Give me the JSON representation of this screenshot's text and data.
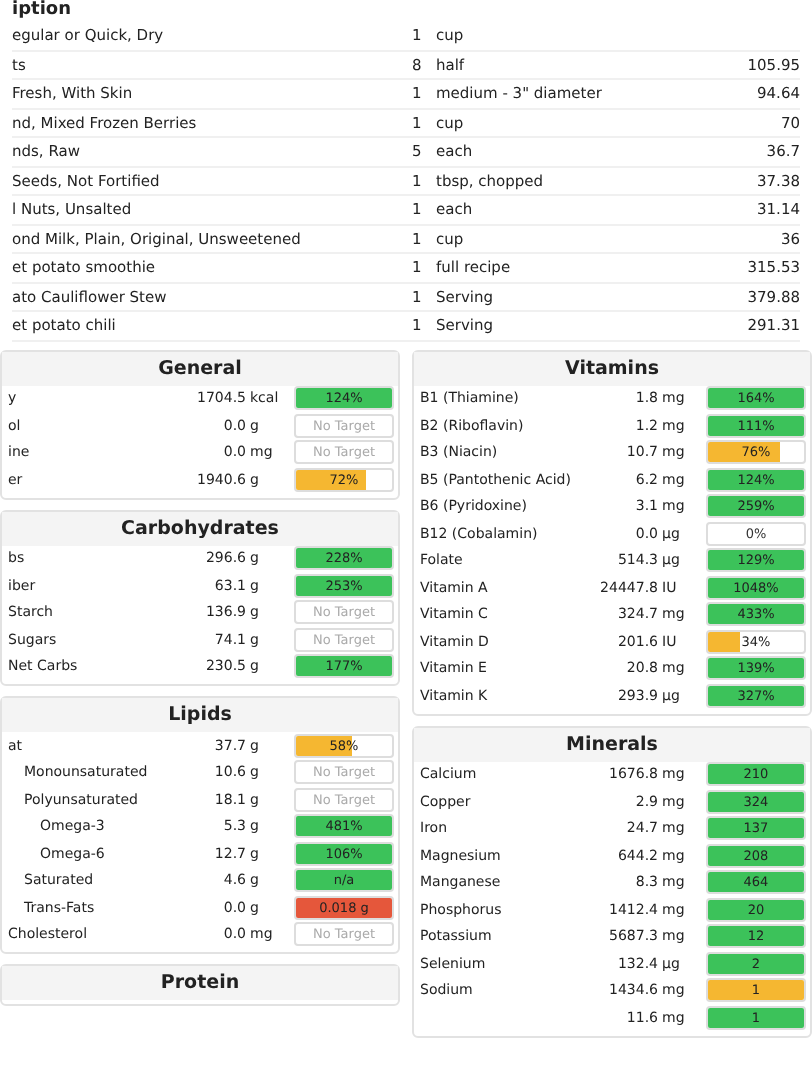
{
  "food_log": {
    "header": "iption",
    "rows": [
      {
        "description": "egular or Quick, Dry",
        "amount": "1",
        "unit": "cup"
      },
      {
        "description": "ts",
        "amount": "8",
        "unit": "half",
        "calories": "105.95"
      },
      {
        "description": "Fresh, With Skin",
        "amount": "1",
        "unit": "medium - 3\" diameter",
        "calories": "94.64"
      },
      {
        "description": "nd, Mixed Frozen Berries",
        "amount": "1",
        "unit": "cup",
        "calories": "70"
      },
      {
        "description": "nds, Raw",
        "amount": "5",
        "unit": "each",
        "calories": "36.7"
      },
      {
        "description": "Seeds, Not Fortified",
        "amount": "1",
        "unit": "tbsp, chopped",
        "calories": "37.38"
      },
      {
        "description": "l Nuts, Unsalted",
        "amount": "1",
        "unit": "each",
        "calories": "31.14"
      },
      {
        "description": "ond Milk, Plain, Original, Unsweetened",
        "amount": "1",
        "unit": "cup",
        "calories": "36"
      },
      {
        "description": "et potato smoothie",
        "amount": "1",
        "unit": "full recipe",
        "calories": "315.53"
      },
      {
        "description": "ato Cauliflower Stew",
        "amount": "1",
        "unit": "Serving",
        "calories": "379.88"
      },
      {
        "description": "et potato chili",
        "amount": "1",
        "unit": "Serving",
        "calories": "291.31"
      }
    ]
  },
  "left_sections": [
    {
      "title": "General",
      "rows": [
        {
          "label": "y",
          "value": "1704.5",
          "unit": "kcal",
          "target": {
            "kind": "bar",
            "text": "124%",
            "level": 1,
            "color": "#3cc25a"
          }
        },
        {
          "label": "ol",
          "value": "0.0",
          "unit": "g",
          "target": {
            "kind": "none",
            "text": "No Target"
          }
        },
        {
          "label": "ine",
          "value": "0.0",
          "unit": "mg",
          "target": {
            "kind": "none",
            "text": "No Target"
          }
        },
        {
          "label": "er",
          "value": "1940.6",
          "unit": "g",
          "target": {
            "kind": "bar",
            "text": "72%",
            "level": 0.72,
            "color": "#f5b731"
          }
        }
      ]
    },
    {
      "title": "Carbohydrates",
      "rows": [
        {
          "label": "bs",
          "value": "296.6",
          "unit": "g",
          "target": {
            "kind": "bar",
            "text": "228%",
            "level": 1,
            "color": "#3cc25a"
          }
        },
        {
          "label": "iber",
          "value": "63.1",
          "unit": "g",
          "target": {
            "kind": "bar",
            "text": "253%",
            "level": 1,
            "color": "#3cc25a"
          }
        },
        {
          "label": "Starch",
          "value": "136.9",
          "unit": "g",
          "target": {
            "kind": "none",
            "text": "No Target"
          }
        },
        {
          "label": "Sugars",
          "value": "74.1",
          "unit": "g",
          "target": {
            "kind": "none",
            "text": "No Target"
          }
        },
        {
          "label": "Net Carbs",
          "value": "230.5",
          "unit": "g",
          "target": {
            "kind": "bar",
            "text": "177%",
            "level": 1,
            "color": "#3cc25a"
          }
        }
      ]
    },
    {
      "title": "Lipids",
      "rows": [
        {
          "label": "at",
          "value": "37.7",
          "unit": "g",
          "target": {
            "kind": "bar",
            "text": "58%",
            "level": 0.58,
            "color": "#f5b731"
          },
          "children": [
            {
              "label": "Monounsaturated",
              "value": "10.6",
              "unit": "g",
              "target": {
                "kind": "none",
                "text": "No Target"
              }
            },
            {
              "label": "Polyunsaturated",
              "value": "18.1",
              "unit": "g",
              "target": {
                "kind": "none",
                "text": "No Target"
              },
              "children": [
                {
                  "label": "Omega-3",
                  "value": "5.3",
                  "unit": "g",
                  "target": {
                    "kind": "bar",
                    "text": "481%",
                    "level": 1,
                    "color": "#3cc25a"
                  }
                },
                {
                  "label": "Omega-6",
                  "value": "12.7",
                  "unit": "g",
                  "target": {
                    "kind": "bar",
                    "text": "106%",
                    "level": 1,
                    "color": "#3cc25a"
                  }
                }
              ]
            },
            {
              "label": "Saturated",
              "value": "4.6",
              "unit": "g",
              "target": {
                "kind": "bar",
                "text": "n/a",
                "level": 1,
                "color": "#3cc25a"
              }
            },
            {
              "label": "Trans-Fats",
              "value": "0.0",
              "unit": "g",
              "target": {
                "kind": "bar",
                "text": "0.018 g",
                "level": 1,
                "color": "#e5573b"
              }
            }
          ]
        },
        {
          "label": "Cholesterol",
          "value": "0.0",
          "unit": "mg",
          "target": {
            "kind": "none",
            "text": "No Target"
          }
        }
      ]
    },
    {
      "title": "Protein"
    }
  ],
  "right_sections": [
    {
      "title": "Vitamins",
      "rows": [
        {
          "label": "B1 (Thiamine)",
          "value": "1.8",
          "unit": "mg",
          "target": {
            "kind": "bar",
            "text": "164%",
            "level": 1,
            "color": "#3cc25a"
          }
        },
        {
          "label": "B2 (Riboflavin)",
          "value": "1.2",
          "unit": "mg",
          "target": {
            "kind": "bar",
            "text": "111%",
            "level": 1,
            "color": "#3cc25a"
          }
        },
        {
          "label": "B3 (Niacin)",
          "value": "10.7",
          "unit": "mg",
          "target": {
            "kind": "bar",
            "text": "76%",
            "level": 0.76,
            "color": "#f5b731"
          }
        },
        {
          "label": "B5 (Pantothenic Acid)",
          "value": "6.2",
          "unit": "mg",
          "target": {
            "kind": "bar",
            "text": "124%",
            "level": 1,
            "color": "#3cc25a"
          }
        },
        {
          "label": "B6 (Pyridoxine)",
          "value": "3.1",
          "unit": "mg",
          "target": {
            "kind": "bar",
            "text": "259%",
            "level": 1,
            "color": "#3cc25a"
          }
        },
        {
          "label": "B12 (Cobalamin)",
          "value": "0.0",
          "unit": "µg",
          "target": {
            "kind": "empty",
            "text": "0%"
          }
        },
        {
          "label": "Folate",
          "value": "514.3",
          "unit": "µg",
          "target": {
            "kind": "bar",
            "text": "129%",
            "level": 1,
            "color": "#3cc25a"
          }
        },
        {
          "label": "Vitamin A",
          "value": "24447.8",
          "unit": "IU",
          "target": {
            "kind": "bar",
            "text": "1048%",
            "level": 1,
            "color": "#3cc25a"
          }
        },
        {
          "label": "Vitamin C",
          "value": "324.7",
          "unit": "mg",
          "target": {
            "kind": "bar",
            "text": "433%",
            "level": 1,
            "color": "#3cc25a"
          }
        },
        {
          "label": "Vitamin D",
          "value": "201.6",
          "unit": "IU",
          "target": {
            "kind": "bar",
            "text": "34%",
            "level": 0.34,
            "color": "#f5b731"
          }
        },
        {
          "label": "Vitamin E",
          "value": "20.8",
          "unit": "mg",
          "target": {
            "kind": "bar",
            "text": "139%",
            "level": 1,
            "color": "#3cc25a"
          }
        },
        {
          "label": "Vitamin K",
          "value": "293.9",
          "unit": "µg",
          "target": {
            "kind": "bar",
            "text": "327%",
            "level": 1,
            "color": "#3cc25a"
          }
        }
      ]
    },
    {
      "title": "Minerals",
      "rows": [
        {
          "label": "Calcium",
          "value": "1676.8",
          "unit": "mg",
          "target": {
            "kind": "bar",
            "text": "210",
            "level": 1,
            "color": "#3cc25a"
          }
        },
        {
          "label": "Copper",
          "value": "2.9",
          "unit": "mg",
          "target": {
            "kind": "bar",
            "text": "324",
            "level": 1,
            "color": "#3cc25a"
          }
        },
        {
          "label": "Iron",
          "value": "24.7",
          "unit": "mg",
          "target": {
            "kind": "bar",
            "text": "137",
            "level": 1,
            "color": "#3cc25a"
          }
        },
        {
          "label": "Magnesium",
          "value": "644.2",
          "unit": "mg",
          "target": {
            "kind": "bar",
            "text": "208",
            "level": 1,
            "color": "#3cc25a"
          }
        },
        {
          "label": "Manganese",
          "value": "8.3",
          "unit": "mg",
          "target": {
            "kind": "bar",
            "text": "464",
            "level": 1,
            "color": "#3cc25a"
          }
        },
        {
          "label": "Phosphorus",
          "value": "1412.4",
          "unit": "mg",
          "target": {
            "kind": "bar",
            "text": "20",
            "level": 1,
            "color": "#3cc25a"
          }
        },
        {
          "label": "Potassium",
          "value": "5687.3",
          "unit": "mg",
          "target": {
            "kind": "bar",
            "text": "12",
            "level": 1,
            "color": "#3cc25a"
          }
        },
        {
          "label": "Selenium",
          "value": "132.4",
          "unit": "µg",
          "target": {
            "kind": "bar",
            "text": "2",
            "level": 1,
            "color": "#3cc25a"
          }
        },
        {
          "label": "Sodium",
          "value": "1434.6",
          "unit": "mg",
          "target": {
            "kind": "bar",
            "text": "1",
            "level": 1,
            "color": "#f5b731"
          }
        },
        {
          "value": "11.6",
          "unit": "mg",
          "target": {
            "kind": "bar",
            "text": "1",
            "level": 1,
            "color": "#3cc25a"
          }
        }
      ]
    }
  ]
}
